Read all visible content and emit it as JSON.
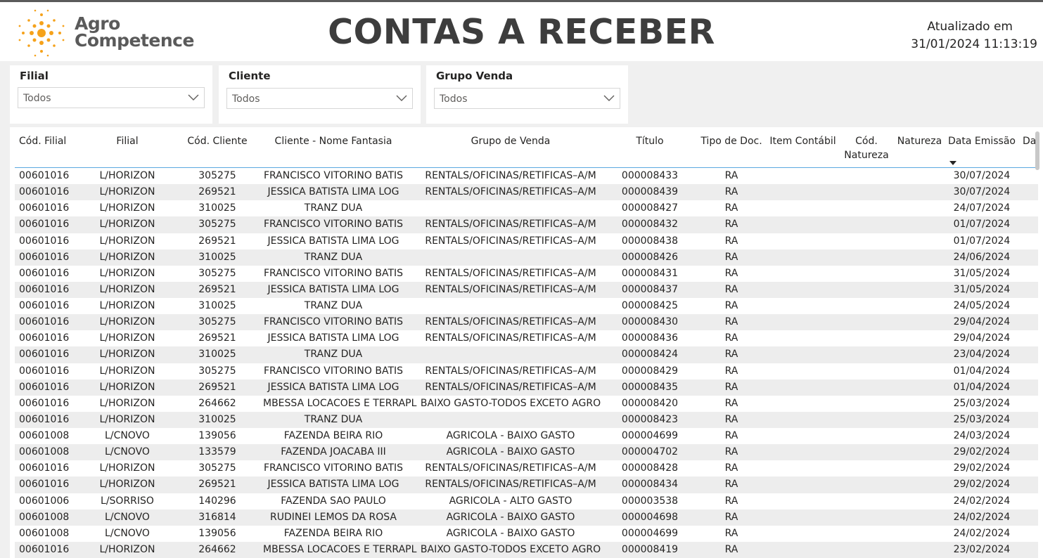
{
  "header": {
    "logo_line1": "Agro",
    "logo_line2": "Competence",
    "title": "CONTAS A RECEBER",
    "updated_label": "Atualizado em",
    "updated_value": "31/01/2024 11:13:19"
  },
  "slicers": [
    {
      "label": "Filial",
      "value": "Todos"
    },
    {
      "label": "Cliente",
      "value": "Todos"
    },
    {
      "label": "Grupo Venda",
      "value": "Todos"
    }
  ],
  "colors": {
    "accent": "#f5a21b",
    "header_line": "#5aa9e0",
    "alt_row": "#ededed"
  },
  "table": {
    "columns": [
      "Cód. Filial",
      "Filial",
      "Cód. Cliente",
      "Cliente - Nome Fantasia",
      "Grupo de Venda",
      "Título",
      "Tipo de Doc.",
      "Item Contábil",
      "Cód.\nNatureza",
      "Natureza",
      "Data Emissão",
      "Da"
    ],
    "rows": [
      [
        "00601016",
        "L/HORIZON",
        "305275",
        "FRANCISCO VITORINO BATIS",
        "RENTALS/OFICINAS/RETIFICAS–A/M",
        "000008433",
        "RA",
        "30/07/2024"
      ],
      [
        "00601016",
        "L/HORIZON",
        "269521",
        "JESSICA BATISTA LIMA LOG",
        "RENTALS/OFICINAS/RETIFICAS–A/M",
        "000008439",
        "RA",
        "30/07/2024"
      ],
      [
        "00601016",
        "L/HORIZON",
        "310025",
        "TRANZ DUA",
        "",
        "000008427",
        "RA",
        "24/07/2024"
      ],
      [
        "00601016",
        "L/HORIZON",
        "305275",
        "FRANCISCO VITORINO BATIS",
        "RENTALS/OFICINAS/RETIFICAS–A/M",
        "000008432",
        "RA",
        "01/07/2024"
      ],
      [
        "00601016",
        "L/HORIZON",
        "269521",
        "JESSICA BATISTA LIMA LOG",
        "RENTALS/OFICINAS/RETIFICAS–A/M",
        "000008438",
        "RA",
        "01/07/2024"
      ],
      [
        "00601016",
        "L/HORIZON",
        "310025",
        "TRANZ DUA",
        "",
        "000008426",
        "RA",
        "24/06/2024"
      ],
      [
        "00601016",
        "L/HORIZON",
        "305275",
        "FRANCISCO VITORINO BATIS",
        "RENTALS/OFICINAS/RETIFICAS–A/M",
        "000008431",
        "RA",
        "31/05/2024"
      ],
      [
        "00601016",
        "L/HORIZON",
        "269521",
        "JESSICA BATISTA LIMA LOG",
        "RENTALS/OFICINAS/RETIFICAS–A/M",
        "000008437",
        "RA",
        "31/05/2024"
      ],
      [
        "00601016",
        "L/HORIZON",
        "310025",
        "TRANZ DUA",
        "",
        "000008425",
        "RA",
        "24/05/2024"
      ],
      [
        "00601016",
        "L/HORIZON",
        "305275",
        "FRANCISCO VITORINO BATIS",
        "RENTALS/OFICINAS/RETIFICAS–A/M",
        "000008430",
        "RA",
        "29/04/2024"
      ],
      [
        "00601016",
        "L/HORIZON",
        "269521",
        "JESSICA BATISTA LIMA LOG",
        "RENTALS/OFICINAS/RETIFICAS–A/M",
        "000008436",
        "RA",
        "29/04/2024"
      ],
      [
        "00601016",
        "L/HORIZON",
        "310025",
        "TRANZ DUA",
        "",
        "000008424",
        "RA",
        "23/04/2024"
      ],
      [
        "00601016",
        "L/HORIZON",
        "305275",
        "FRANCISCO VITORINO BATIS",
        "RENTALS/OFICINAS/RETIFICAS–A/M",
        "000008429",
        "RA",
        "01/04/2024"
      ],
      [
        "00601016",
        "L/HORIZON",
        "269521",
        "JESSICA BATISTA LIMA LOG",
        "RENTALS/OFICINAS/RETIFICAS–A/M",
        "000008435",
        "RA",
        "01/04/2024"
      ],
      [
        "00601016",
        "L/HORIZON",
        "264662",
        "MBESSA LOCACOES E TERRAPL",
        "BAIXO GASTO-TODOS EXCETO AGRO",
        "000008420",
        "RA",
        "25/03/2024"
      ],
      [
        "00601016",
        "L/HORIZON",
        "310025",
        "TRANZ DUA",
        "",
        "000008423",
        "RA",
        "25/03/2024"
      ],
      [
        "00601008",
        "L/CNOVO",
        "139056",
        "FAZENDA BEIRA RIO",
        "AGRICOLA - BAIXO GASTO",
        "000004699",
        "RA",
        "24/03/2024"
      ],
      [
        "00601008",
        "L/CNOVO",
        "133579",
        "FAZENDA JOACABA III",
        "AGRICOLA - BAIXO GASTO",
        "000004702",
        "RA",
        "29/02/2024"
      ],
      [
        "00601016",
        "L/HORIZON",
        "305275",
        "FRANCISCO VITORINO BATIS",
        "RENTALS/OFICINAS/RETIFICAS–A/M",
        "000008428",
        "RA",
        "29/02/2024"
      ],
      [
        "00601016",
        "L/HORIZON",
        "269521",
        "JESSICA BATISTA LIMA LOG",
        "RENTALS/OFICINAS/RETIFICAS–A/M",
        "000008434",
        "RA",
        "29/02/2024"
      ],
      [
        "00601006",
        "L/SORRISO",
        "140296",
        "FAZENDA SAO PAULO",
        "AGRICOLA - ALTO GASTO",
        "000003538",
        "RA",
        "24/02/2024"
      ],
      [
        "00601008",
        "L/CNOVO",
        "316814",
        "RUDINEI LEMOS DA ROSA",
        "AGRICOLA - BAIXO GASTO",
        "000004698",
        "RA",
        "24/02/2024"
      ],
      [
        "00601008",
        "L/CNOVO",
        "139056",
        "FAZENDA BEIRA RIO",
        "AGRICOLA - BAIXO GASTO",
        "000004699",
        "RA",
        "24/02/2024"
      ],
      [
        "00601016",
        "L/HORIZON",
        "264662",
        "MBESSA LOCACOES E TERRAPL",
        "BAIXO GASTO-TODOS EXCETO AGRO",
        "000008419",
        "RA",
        "23/02/2024"
      ]
    ]
  }
}
